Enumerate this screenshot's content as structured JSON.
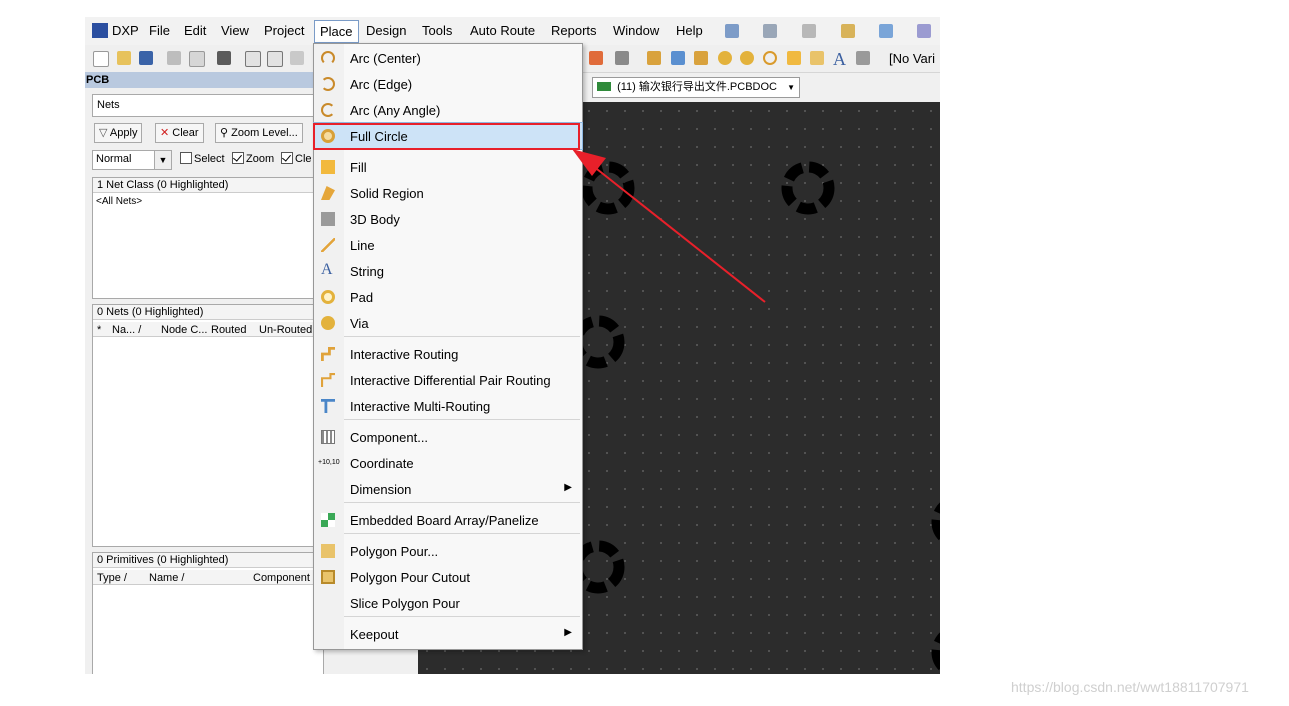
{
  "menubar": {
    "items": [
      {
        "label": "DXP"
      },
      {
        "label": "File"
      },
      {
        "label": "Edit"
      },
      {
        "label": "View"
      },
      {
        "label": "Project"
      },
      {
        "label": "Place"
      },
      {
        "label": "Design"
      },
      {
        "label": "Tools"
      },
      {
        "label": "Auto Route"
      },
      {
        "label": "Reports"
      },
      {
        "label": "Window"
      },
      {
        "label": "Help"
      }
    ]
  },
  "toolbar": {
    "variant_label": "[No Vari"
  },
  "document_tab": {
    "label": "(11) 输次银行导出文件.PCBDOC"
  },
  "pcb_panel": {
    "title": "PCB",
    "mode_value": "Nets",
    "apply_label": "Apply",
    "clear_label": "Clear",
    "zoom_level_label": "Zoom Level...",
    "mask_value": "Normal",
    "select_label": "Select",
    "zoom_label": "Zoom",
    "clear_check_label": "Cle",
    "net_class_header": "1 Net Class (0 Highlighted)",
    "net_class_item": "<All Nets>",
    "nets_header": "0 Nets (0 Highlighted)",
    "nets_columns": [
      "*",
      "Na... /",
      "Node C...",
      "Routed",
      "Un-Routed"
    ],
    "primitives_header": "0 Primitives (0 Highlighted)",
    "primitives_columns": [
      "Type /",
      "Name /",
      "Component"
    ]
  },
  "place_menu": {
    "items": [
      {
        "label": "Arc (Center)",
        "icon": "arc-center-icon"
      },
      {
        "label": "Arc (Edge)",
        "icon": "arc-edge-icon"
      },
      {
        "label": "Arc (Any Angle)",
        "icon": "arc-any-angle-icon"
      },
      {
        "label": "Full Circle",
        "icon": "full-circle-icon"
      },
      {
        "label": "Fill",
        "icon": "fill-icon"
      },
      {
        "label": "Solid Region",
        "icon": "solid-region-icon"
      },
      {
        "label": "3D Body",
        "icon": "3d-body-icon"
      },
      {
        "label": "Line",
        "icon": "line-icon"
      },
      {
        "label": "String",
        "icon": "string-icon"
      },
      {
        "label": "Pad",
        "icon": "pad-icon"
      },
      {
        "label": "Via",
        "icon": "via-icon"
      },
      {
        "label": "Interactive Routing",
        "icon": "interactive-routing-icon"
      },
      {
        "label": "Interactive Differential Pair Routing",
        "icon": "diff-pair-routing-icon"
      },
      {
        "label": "Interactive Multi-Routing",
        "icon": "multi-routing-icon"
      },
      {
        "label": "Component...",
        "icon": "component-icon"
      },
      {
        "label": "Coordinate",
        "icon": "coordinate-icon"
      },
      {
        "label": "Dimension",
        "icon": "dimension-icon"
      },
      {
        "label": "Embedded Board Array/Panelize",
        "icon": "board-array-icon"
      },
      {
        "label": "Polygon Pour...",
        "icon": "polygon-pour-icon"
      },
      {
        "label": "Polygon Pour Cutout",
        "icon": "polygon-cutout-icon"
      },
      {
        "label": "Slice Polygon Pour",
        "icon": "slice-polygon-icon"
      },
      {
        "label": "Keepout",
        "icon": "keepout-icon"
      }
    ],
    "highlighted": "Full Circle",
    "coordinate_icon_text": "+10,10"
  },
  "watermark": "https://blog.csdn.net/wwt18811707971",
  "colors": {
    "highlight_bg": "#cde3f7",
    "annotation_red": "#e8202a",
    "canvas_bg": "#2c2c2c"
  }
}
